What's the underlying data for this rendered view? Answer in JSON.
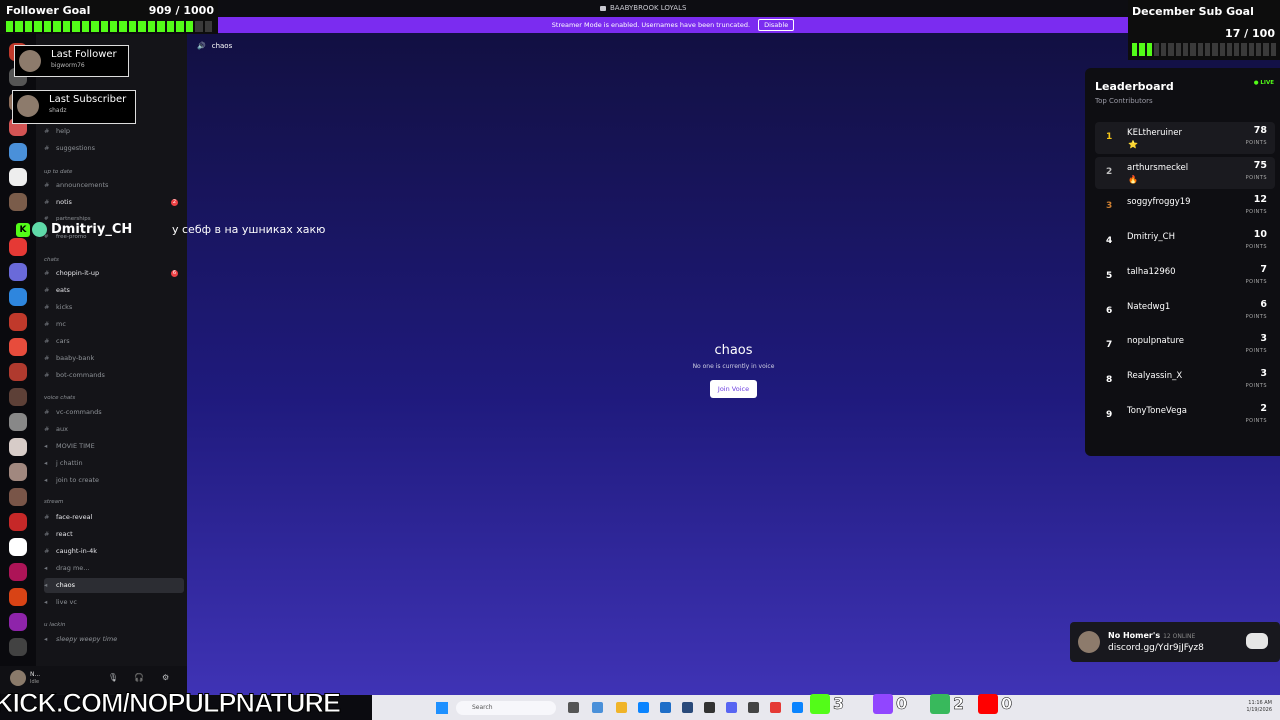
{
  "window": {
    "title": "BAABYBROOK LOYALS"
  },
  "streamer_banner": {
    "text": "Streamer Mode is enabled. Usernames have been truncated.",
    "disable_label": "Disable"
  },
  "follower_goal": {
    "label": "Follower Goal",
    "count": "909 / 1000",
    "progress": 0.909
  },
  "sub_goal": {
    "label": "December Sub Goal",
    "count": "17 / 100",
    "progress": 0.17
  },
  "last_follower": {
    "title": "Last Follower",
    "name": "bigworm76"
  },
  "last_subscriber": {
    "title": "Last Subscriber",
    "name": "shadz"
  },
  "server": {
    "name": "BAABYBROOK LOYALS"
  },
  "channels": {
    "help": "help",
    "suggestions": "suggestions",
    "cat_up_to_date": "up to date",
    "announcements": "announcements",
    "notis": "notis",
    "notis_badge": "2",
    "partnerships": "partnerships",
    "free_promo": "free-promo",
    "cat_chats": "chats",
    "choppin": "choppin-it-up",
    "choppin_badge": "6",
    "eats": "eats",
    "kicks": "kicks",
    "mc": "mc",
    "cars": "cars",
    "baaby_bank": "baaby-bank",
    "bot_commands": "bot-commands",
    "cat_voice": "voice chats",
    "vc_commands": "vc-commands",
    "aux": "aux",
    "movie_time": "MOVIE TIME",
    "j_chattin": "j chattin",
    "join_to_create": "join to create",
    "cat_stream": "stream",
    "face_reveal": "face-reveal",
    "react": "react",
    "caught_in_4k": "caught-in-4k",
    "drag_me": "drag me...",
    "chaos": "chaos",
    "live_vc": "live vc",
    "cat_u_lackin": "u lackin",
    "sleepy": "sleepy weepy time"
  },
  "user_panel": {
    "name": "N...",
    "status": "Idle"
  },
  "chat_overlay": {
    "username": "Dmitriy_CH",
    "message": "у себф в на ушниках хакю"
  },
  "main_view": {
    "channel_name": "chaos",
    "voice_title": "chaos",
    "voice_subtitle": "No one is currently in voice",
    "join_label": "Join Voice"
  },
  "leaderboard": {
    "title": "Leaderboard",
    "subtitle": "Top Contributors",
    "live_label": "LIVE",
    "points_label": "POINTS",
    "entries": [
      {
        "rank": "1",
        "name": "KELtheruiner",
        "points": "78",
        "emoji": "⭐"
      },
      {
        "rank": "2",
        "name": "arthursmeckel",
        "points": "75",
        "emoji": "🔥"
      },
      {
        "rank": "3",
        "name": "soggyfroggy19",
        "points": "12",
        "emoji": ""
      },
      {
        "rank": "4",
        "name": "Dmitriy_CH",
        "points": "10",
        "emoji": ""
      },
      {
        "rank": "5",
        "name": "talha12960",
        "points": "7",
        "emoji": ""
      },
      {
        "rank": "6",
        "name": "Natedwg1",
        "points": "6",
        "emoji": ""
      },
      {
        "rank": "7",
        "name": "nopulpnature",
        "points": "3",
        "emoji": ""
      },
      {
        "rank": "8",
        "name": "Realyassin_X",
        "points": "3",
        "emoji": ""
      },
      {
        "rank": "9",
        "name": "TonyToneVega",
        "points": "2",
        "emoji": ""
      }
    ],
    "rank_colors": {
      "1": "#f5c518",
      "2": "#c0c0c0",
      "3": "#cd7f32"
    }
  },
  "discord_widget": {
    "server": "No Homer's",
    "online": "12 ONLINE",
    "link": "discord.gg/Ydr9jJFyz8"
  },
  "kick_url": "KICK.COM/NOPULPNATURE",
  "taskbar": {
    "search_placeholder": "Search",
    "time": "11:16 AM",
    "date": "1/19/2026"
  },
  "platform_stats": {
    "kick": "3",
    "twitch": "0",
    "rumble": "2",
    "youtube": "0"
  },
  "colors": {
    "kick_green": "#53fc18",
    "streamer_purple": "#7b2cf0",
    "twitch_purple": "#9146ff",
    "youtube_red": "#ff0000"
  }
}
